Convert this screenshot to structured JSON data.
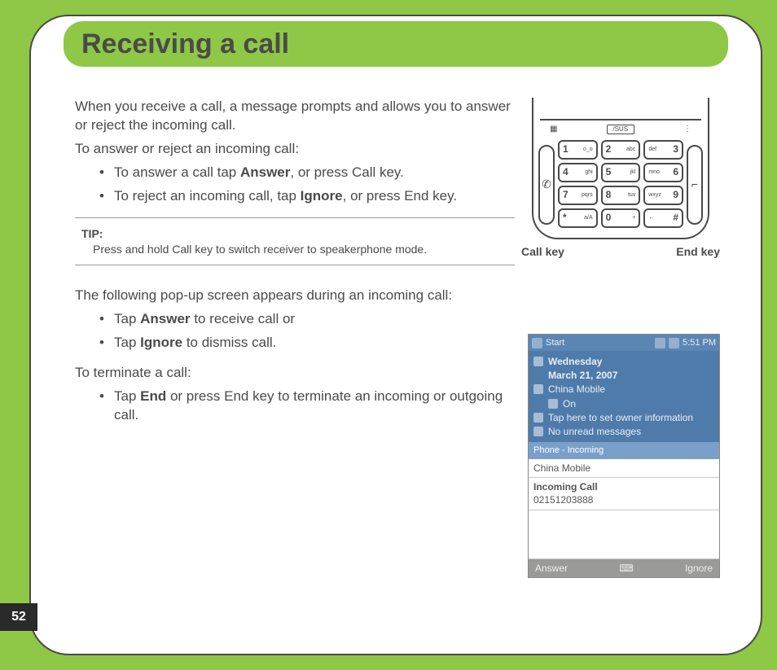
{
  "title": "Receiving a call",
  "intro1": "When you receive a call, a message prompts and allows you to answer or reject the incoming call.",
  "intro2": "To answer or reject an incoming call:",
  "bullets1": {
    "b1_pre": "To answer a call tap ",
    "b1_bold": "Answer",
    "b1_post": ", or press Call key.",
    "b2_pre": "To reject an incoming call, tap ",
    "b2_bold": "Ignore",
    "b2_post": ", or press End key."
  },
  "tip": {
    "label": "TIP:",
    "body": "Press and hold Call key to switch receiver to speakerphone mode."
  },
  "mid_intro": "The following pop-up screen appears during an incoming call:",
  "bullets2": {
    "b1_pre": "Tap ",
    "b1_bold": "Answer",
    "b1_post": " to receive call or",
    "b2_pre": "Tap ",
    "b2_bold": "Ignore",
    "b2_post": " to dismiss call."
  },
  "terminate_heading": "To terminate a call:",
  "bullets3": {
    "b1_pre": "Tap ",
    "b1_bold": "End",
    "b1_post": " or press End key to terminate an incoming or outgoing call."
  },
  "phone": {
    "logo": "/SUS",
    "call_label": "Call key",
    "end_label": "End key",
    "call_glyph": "✆",
    "end_glyph": "⌐",
    "keys": [
      {
        "n": "1",
        "l": "o_o"
      },
      {
        "n": "2",
        "l": "abc"
      },
      {
        "n": "def",
        "r": "3"
      },
      {
        "n": "4",
        "l": "ghi"
      },
      {
        "n": "5",
        "l": "jkl"
      },
      {
        "n": "mno",
        "r": "6"
      },
      {
        "n": "7",
        "l": "pqrs"
      },
      {
        "n": "8",
        "l": "tuv"
      },
      {
        "n": "wxyz",
        "r": "9"
      },
      {
        "n": "*",
        "l": "a/A"
      },
      {
        "n": "0",
        "l": "+"
      },
      {
        "n": "←",
        "r": "#"
      }
    ]
  },
  "screenshot": {
    "start": "Start",
    "time": "5:51 PM",
    "day": "Wednesday",
    "date": "March 21, 2007",
    "carrier": "China Mobile",
    "profile": "On",
    "owner": "Tap here to set owner information",
    "unread": "No unread messages",
    "popup_header": "Phone - Incoming",
    "popup_operator": "China Mobile",
    "popup_title": "Incoming Call",
    "popup_number": "02151203888",
    "soft_left": "Answer",
    "soft_right": "Ignore"
  },
  "page_number": "52"
}
